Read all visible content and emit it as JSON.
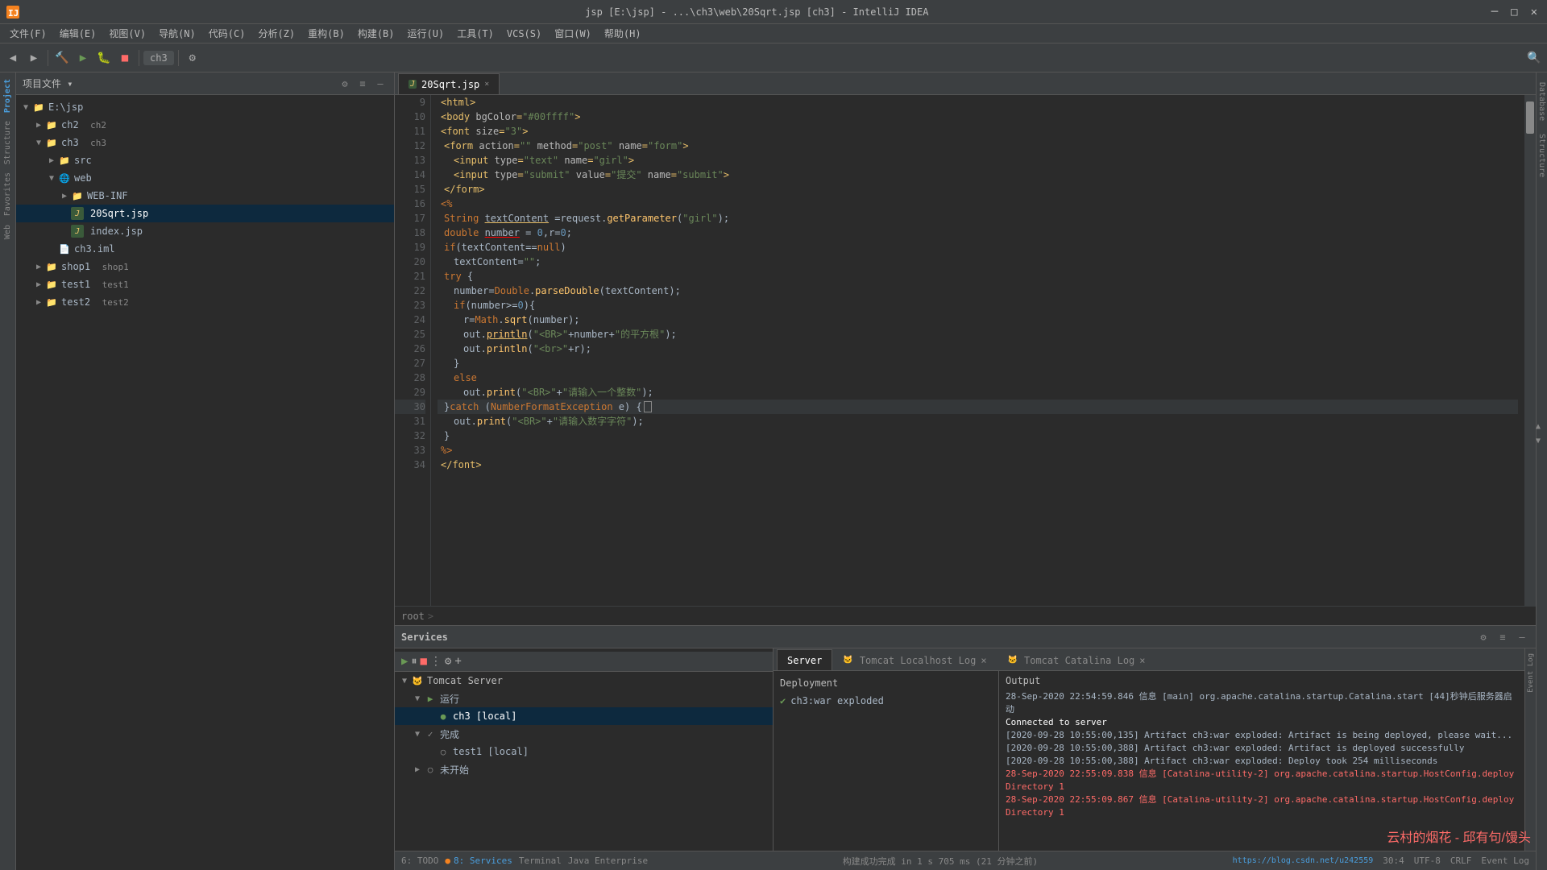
{
  "titlebar": {
    "title": "jsp [E:\\jsp] - ...\\ch3\\web\\20Sqrt.jsp [ch3] - IntelliJ IDEA",
    "minimize": "─",
    "maximize": "□",
    "close": "✕"
  },
  "menubar": {
    "items": [
      "文件(F)",
      "编辑(E)",
      "视图(V)",
      "导航(N)",
      "代码(C)",
      "分析(Z)",
      "重构(B)",
      "构建(B)",
      "运行(U)",
      "工具(T)",
      "VCS(S)",
      "窗口(W)",
      "帮助(H)"
    ]
  },
  "toolbar": {
    "branch": "ch3",
    "run_icon": "▶",
    "debug_icon": "🐛"
  },
  "project": {
    "title": "项目文件",
    "tree": [
      {
        "id": "ejsp",
        "label": "E:\\jsp",
        "level": 0,
        "expanded": true,
        "icon": "📁",
        "type": "root"
      },
      {
        "id": "ch2",
        "label": "ch2",
        "level": 1,
        "expanded": false,
        "icon": "📁",
        "type": "folder",
        "extra": "ch2"
      },
      {
        "id": "ch3",
        "label": "ch3",
        "level": 1,
        "expanded": true,
        "icon": "📁",
        "type": "folder",
        "extra": "ch3"
      },
      {
        "id": "src",
        "label": "src",
        "level": 2,
        "expanded": false,
        "icon": "📁",
        "type": "folder"
      },
      {
        "id": "web",
        "label": "web",
        "level": 2,
        "expanded": true,
        "icon": "🌐",
        "type": "web"
      },
      {
        "id": "webinf",
        "label": "WEB-INF",
        "level": 3,
        "expanded": false,
        "icon": "📁",
        "type": "folder"
      },
      {
        "id": "20sqrt",
        "label": "20Sqrt.jsp",
        "level": 3,
        "expanded": false,
        "icon": "J",
        "type": "jsp",
        "selected": true
      },
      {
        "id": "index",
        "label": "index.jsp",
        "level": 3,
        "expanded": false,
        "icon": "J",
        "type": "jsp"
      },
      {
        "id": "ch3iml",
        "label": "ch3.iml",
        "level": 2,
        "expanded": false,
        "icon": "📄",
        "type": "iml"
      },
      {
        "id": "shop1",
        "label": "shop1",
        "level": 1,
        "expanded": false,
        "icon": "📁",
        "type": "folder",
        "extra": "shop1"
      },
      {
        "id": "test1",
        "label": "test1",
        "level": 1,
        "expanded": false,
        "icon": "📁",
        "type": "folder",
        "extra": "test1"
      },
      {
        "id": "test2",
        "label": "test2",
        "level": 1,
        "expanded": false,
        "icon": "📁",
        "type": "folder",
        "extra": "test2"
      }
    ]
  },
  "editor": {
    "filename": "20Sqrt.jsp",
    "tab_close": "×",
    "lines": [
      {
        "n": 9,
        "code": "    <html>"
      },
      {
        "n": 10,
        "code": "    <body bgColor=\"#00ffff\">"
      },
      {
        "n": 11,
        "code": "    <font size=\"3\">"
      },
      {
        "n": 12,
        "code": "        <form action=\"\" method=\"post\" name=\"form\">"
      },
      {
        "n": 13,
        "code": "            <input type=\"text\" name=\"girl\">"
      },
      {
        "n": 14,
        "code": "            <input type=\"submit\" value=\"提交\" name=\"submit\">"
      },
      {
        "n": 15,
        "code": "        </form>"
      },
      {
        "n": 16,
        "code": "    <%"
      },
      {
        "n": 17,
        "code": "        String textContent =request.getParameter(\"girl\");"
      },
      {
        "n": 18,
        "code": "        double number = 0,r=0;"
      },
      {
        "n": 19,
        "code": "        if(textContent==null)"
      },
      {
        "n": 20,
        "code": "            textContent=\"\";"
      },
      {
        "n": 21,
        "code": "        try {"
      },
      {
        "n": 22,
        "code": "            number=Double.parseDouble(textContent);"
      },
      {
        "n": 23,
        "code": "            if(number>=0){"
      },
      {
        "n": 24,
        "code": "                r=Math.sqrt(number);"
      },
      {
        "n": 25,
        "code": "                out.println(\"<BR>\"+number+\"的平方根\");"
      },
      {
        "n": 26,
        "code": "                out.println(\"<br>\"+r);"
      },
      {
        "n": 27,
        "code": "            }"
      },
      {
        "n": 28,
        "code": "            else"
      },
      {
        "n": 29,
        "code": "                out.print(\"<BR>\"+\"请输入一个整数\");"
      },
      {
        "n": 30,
        "code": "        }catch (NumberFormatException e) {"
      },
      {
        "n": 31,
        "code": "            out.print(\"<BR>\"+\"请输入数字字符\");"
      },
      {
        "n": 32,
        "code": "        }"
      },
      {
        "n": 33,
        "code": "    %>"
      },
      {
        "n": 34,
        "code": "    </font>"
      }
    ],
    "breadcrumb": [
      "root",
      ">"
    ]
  },
  "services": {
    "title": "Services",
    "tree": [
      {
        "id": "tomcat",
        "label": "Tomcat Server",
        "level": 0,
        "expanded": true,
        "type": "server"
      },
      {
        "id": "running",
        "label": "运行",
        "level": 1,
        "expanded": true,
        "type": "group"
      },
      {
        "id": "ch3local",
        "label": "ch3 [local]",
        "level": 2,
        "expanded": false,
        "type": "instance",
        "selected": true
      },
      {
        "id": "complete",
        "label": "完成",
        "level": 1,
        "expanded": true,
        "type": "group"
      },
      {
        "id": "test1local",
        "label": "test1 [local]",
        "level": 2,
        "expanded": false,
        "type": "instance"
      },
      {
        "id": "notstarted",
        "label": "未开始",
        "level": 1,
        "expanded": false,
        "type": "group"
      }
    ]
  },
  "server_tabs": [
    {
      "id": "server",
      "label": "Server",
      "active": true
    },
    {
      "id": "tomcat_localhost",
      "label": "Tomcat Localhost Log",
      "active": false
    },
    {
      "id": "tomcat_catalina",
      "label": "Tomcat Catalina Log",
      "active": false
    }
  ],
  "deployment": {
    "title": "Deployment",
    "items": [
      {
        "label": "ch3:war exploded",
        "status": "ok"
      }
    ]
  },
  "output": {
    "title": "Output",
    "lines": [
      {
        "text": "28-Sep-2020 22:54:59.846 信息 [main] org.apache.catalina.startup.Catalina.start [44]秒钟后服务器启动",
        "style": "plain"
      },
      {
        "text": "Connected to server",
        "style": "bold"
      },
      {
        "text": "[2020-09-28 10:55:00,135] Artifact ch3:war exploded: Artifact is being deployed, please wait...",
        "style": "plain"
      },
      {
        "text": "[2020-09-28 10:55:00,388] Artifact ch3:war exploded: Artifact is deployed successfully",
        "style": "plain"
      },
      {
        "text": "[2020-09-28 10:55:00,388] Artifact ch3:war exploded: Deploy took 254 milliseconds",
        "style": "plain"
      },
      {
        "text": "28-Sep-2020 22:55:09.838 信息 [Catalina-utility-2] org.apache.catalina.startup.HostConfig.deployDirectory 1",
        "style": "red"
      },
      {
        "text": "28-Sep-2020 22:55:09.867 信息 [Catalina-utility-2] org.apache.catalina.startup.HostConfig.deployDirectory 1",
        "style": "red"
      }
    ]
  },
  "statusbar": {
    "build_msg": "构建成功完成 in 1 s 705 ms (21 分钟之前)",
    "todo_label": "6: TODO",
    "services_label": "8: Services",
    "terminal_label": "Terminal",
    "java_enterprise": "Java Enterprise",
    "event_log": "Event Log",
    "position": "30:4",
    "encoding": "UTF-8",
    "line_sep": "CRLF",
    "url": "https://blog.csdn.net/u242559"
  },
  "watermark": "云村的烟花 - 邱有句/馒头",
  "right_panels": [
    "Database",
    "Structure"
  ]
}
